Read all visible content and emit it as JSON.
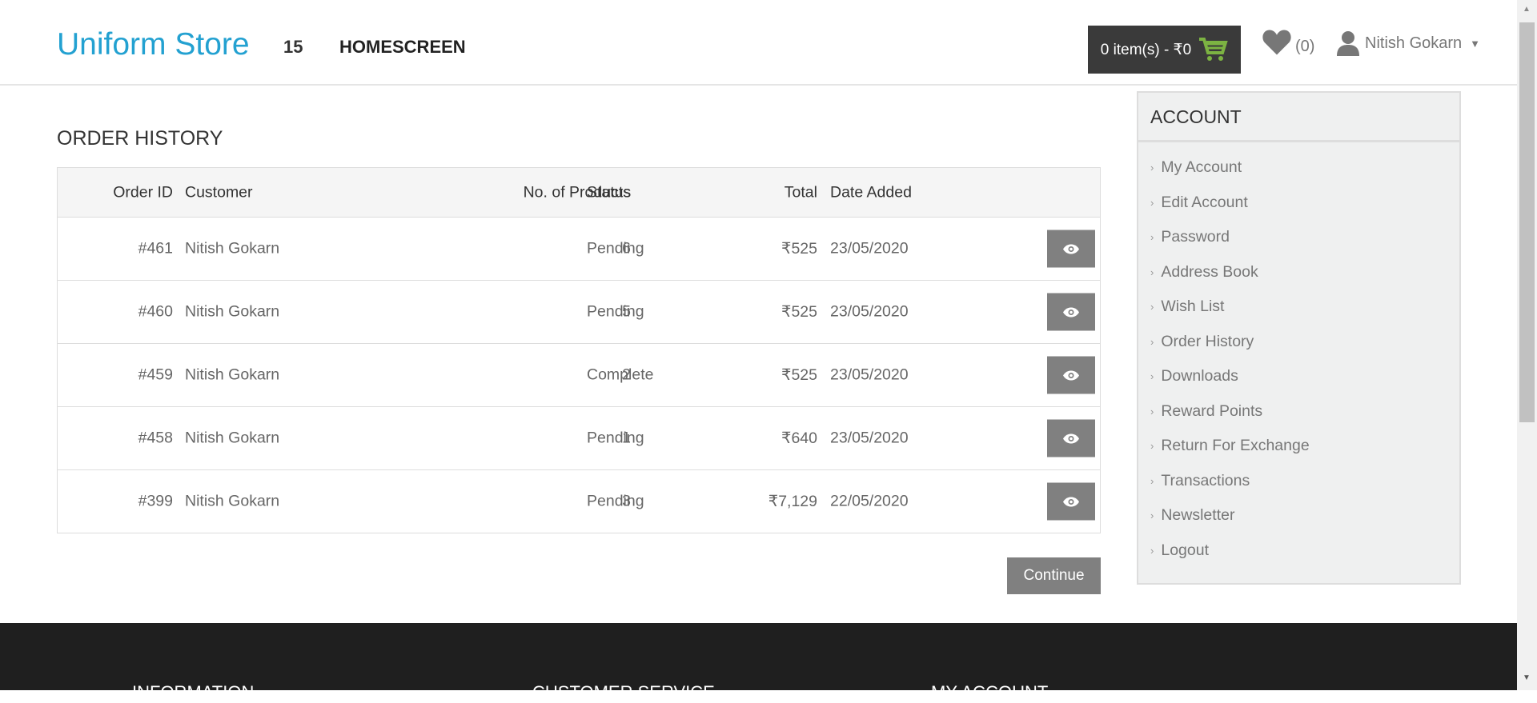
{
  "header": {
    "logo": "Uniform Store",
    "number": "15",
    "nav": "HOMESCREEN",
    "cart": "0 item(s) - ₹0",
    "wishlist_count": "(0)",
    "user": "Nitish Gokarn"
  },
  "page": {
    "title": "ORDER HISTORY",
    "continue": "Continue"
  },
  "table": {
    "columns": [
      "Order ID",
      "Customer",
      "No. of Products",
      "Status",
      "Total",
      "Date Added"
    ],
    "rows": [
      [
        "#461",
        "Nitish Gokarn",
        "6",
        "Pending",
        "₹525",
        "23/05/2020"
      ],
      [
        "#460",
        "Nitish Gokarn",
        "5",
        "Pending",
        "₹525",
        "23/05/2020"
      ],
      [
        "#459",
        "Nitish Gokarn",
        "2",
        "Complete",
        "₹525",
        "23/05/2020"
      ],
      [
        "#458",
        "Nitish Gokarn",
        "1",
        "Pending",
        "₹640",
        "23/05/2020"
      ],
      [
        "#399",
        "Nitish Gokarn",
        "3",
        "Pending",
        "₹7,129",
        "22/05/2020"
      ]
    ]
  },
  "account": {
    "title": "ACCOUNT",
    "items": [
      "My Account",
      "Edit Account",
      "Password",
      "Address Book",
      "Wish List",
      "Order History",
      "Downloads",
      "Reward Points",
      "Return For Exchange",
      "Transactions",
      "Newsletter",
      "Logout"
    ]
  },
  "footer": {
    "headings": [
      "INFORMATION",
      "CUSTOMER SERVICE",
      "MY ACCOUNT"
    ]
  },
  "colors": {
    "brand": "#23a1d1",
    "cart_icon": "#7cb342"
  }
}
